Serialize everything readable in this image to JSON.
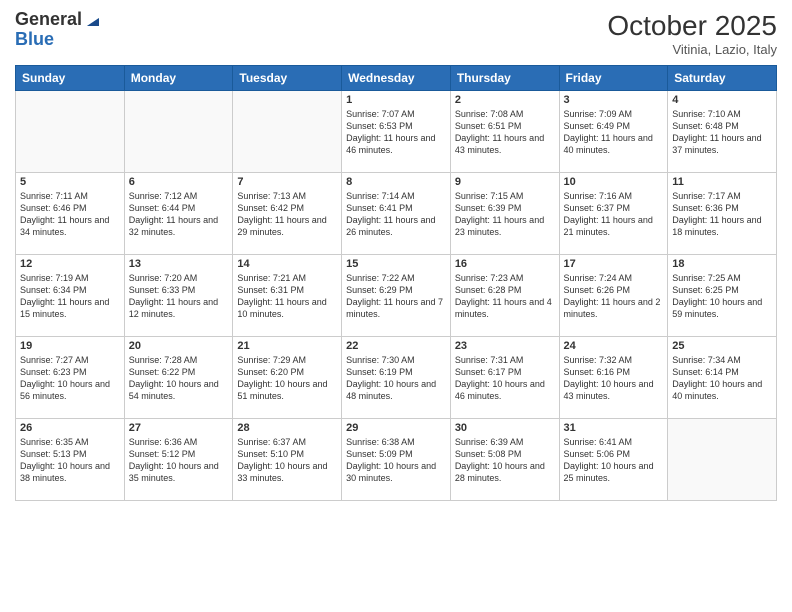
{
  "header": {
    "logo_line1": "General",
    "logo_line2": "Blue",
    "month": "October 2025",
    "location": "Vitinia, Lazio, Italy"
  },
  "weekdays": [
    "Sunday",
    "Monday",
    "Tuesday",
    "Wednesday",
    "Thursday",
    "Friday",
    "Saturday"
  ],
  "weeks": [
    [
      {
        "day": "",
        "info": ""
      },
      {
        "day": "",
        "info": ""
      },
      {
        "day": "",
        "info": ""
      },
      {
        "day": "1",
        "info": "Sunrise: 7:07 AM\nSunset: 6:53 PM\nDaylight: 11 hours and 46 minutes."
      },
      {
        "day": "2",
        "info": "Sunrise: 7:08 AM\nSunset: 6:51 PM\nDaylight: 11 hours and 43 minutes."
      },
      {
        "day": "3",
        "info": "Sunrise: 7:09 AM\nSunset: 6:49 PM\nDaylight: 11 hours and 40 minutes."
      },
      {
        "day": "4",
        "info": "Sunrise: 7:10 AM\nSunset: 6:48 PM\nDaylight: 11 hours and 37 minutes."
      }
    ],
    [
      {
        "day": "5",
        "info": "Sunrise: 7:11 AM\nSunset: 6:46 PM\nDaylight: 11 hours and 34 minutes."
      },
      {
        "day": "6",
        "info": "Sunrise: 7:12 AM\nSunset: 6:44 PM\nDaylight: 11 hours and 32 minutes."
      },
      {
        "day": "7",
        "info": "Sunrise: 7:13 AM\nSunset: 6:42 PM\nDaylight: 11 hours and 29 minutes."
      },
      {
        "day": "8",
        "info": "Sunrise: 7:14 AM\nSunset: 6:41 PM\nDaylight: 11 hours and 26 minutes."
      },
      {
        "day": "9",
        "info": "Sunrise: 7:15 AM\nSunset: 6:39 PM\nDaylight: 11 hours and 23 minutes."
      },
      {
        "day": "10",
        "info": "Sunrise: 7:16 AM\nSunset: 6:37 PM\nDaylight: 11 hours and 21 minutes."
      },
      {
        "day": "11",
        "info": "Sunrise: 7:17 AM\nSunset: 6:36 PM\nDaylight: 11 hours and 18 minutes."
      }
    ],
    [
      {
        "day": "12",
        "info": "Sunrise: 7:19 AM\nSunset: 6:34 PM\nDaylight: 11 hours and 15 minutes."
      },
      {
        "day": "13",
        "info": "Sunrise: 7:20 AM\nSunset: 6:33 PM\nDaylight: 11 hours and 12 minutes."
      },
      {
        "day": "14",
        "info": "Sunrise: 7:21 AM\nSunset: 6:31 PM\nDaylight: 11 hours and 10 minutes."
      },
      {
        "day": "15",
        "info": "Sunrise: 7:22 AM\nSunset: 6:29 PM\nDaylight: 11 hours and 7 minutes."
      },
      {
        "day": "16",
        "info": "Sunrise: 7:23 AM\nSunset: 6:28 PM\nDaylight: 11 hours and 4 minutes."
      },
      {
        "day": "17",
        "info": "Sunrise: 7:24 AM\nSunset: 6:26 PM\nDaylight: 11 hours and 2 minutes."
      },
      {
        "day": "18",
        "info": "Sunrise: 7:25 AM\nSunset: 6:25 PM\nDaylight: 10 hours and 59 minutes."
      }
    ],
    [
      {
        "day": "19",
        "info": "Sunrise: 7:27 AM\nSunset: 6:23 PM\nDaylight: 10 hours and 56 minutes."
      },
      {
        "day": "20",
        "info": "Sunrise: 7:28 AM\nSunset: 6:22 PM\nDaylight: 10 hours and 54 minutes."
      },
      {
        "day": "21",
        "info": "Sunrise: 7:29 AM\nSunset: 6:20 PM\nDaylight: 10 hours and 51 minutes."
      },
      {
        "day": "22",
        "info": "Sunrise: 7:30 AM\nSunset: 6:19 PM\nDaylight: 10 hours and 48 minutes."
      },
      {
        "day": "23",
        "info": "Sunrise: 7:31 AM\nSunset: 6:17 PM\nDaylight: 10 hours and 46 minutes."
      },
      {
        "day": "24",
        "info": "Sunrise: 7:32 AM\nSunset: 6:16 PM\nDaylight: 10 hours and 43 minutes."
      },
      {
        "day": "25",
        "info": "Sunrise: 7:34 AM\nSunset: 6:14 PM\nDaylight: 10 hours and 40 minutes."
      }
    ],
    [
      {
        "day": "26",
        "info": "Sunrise: 6:35 AM\nSunset: 5:13 PM\nDaylight: 10 hours and 38 minutes."
      },
      {
        "day": "27",
        "info": "Sunrise: 6:36 AM\nSunset: 5:12 PM\nDaylight: 10 hours and 35 minutes."
      },
      {
        "day": "28",
        "info": "Sunrise: 6:37 AM\nSunset: 5:10 PM\nDaylight: 10 hours and 33 minutes."
      },
      {
        "day": "29",
        "info": "Sunrise: 6:38 AM\nSunset: 5:09 PM\nDaylight: 10 hours and 30 minutes."
      },
      {
        "day": "30",
        "info": "Sunrise: 6:39 AM\nSunset: 5:08 PM\nDaylight: 10 hours and 28 minutes."
      },
      {
        "day": "31",
        "info": "Sunrise: 6:41 AM\nSunset: 5:06 PM\nDaylight: 10 hours and 25 minutes."
      },
      {
        "day": "",
        "info": ""
      }
    ]
  ]
}
